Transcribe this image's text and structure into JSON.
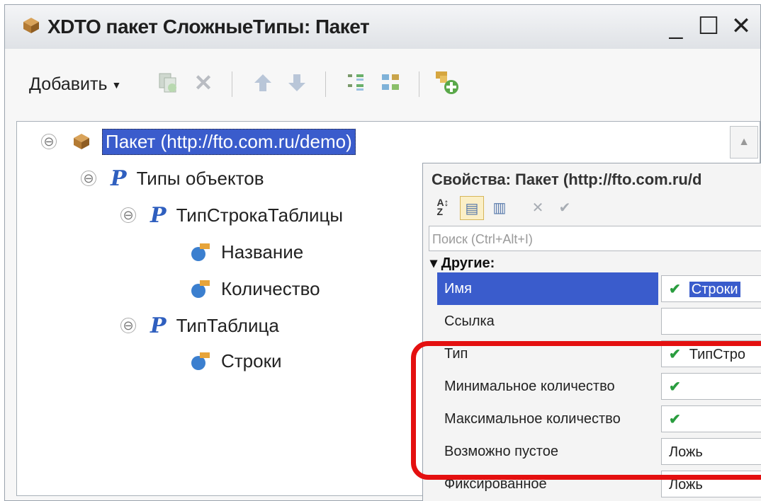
{
  "window": {
    "title": "XDTO пакет СложныеТипы: Пакет",
    "buttons": {
      "minimize": "_",
      "maximize": "☐",
      "close": "✕"
    }
  },
  "toolbar": {
    "add_label": "Добавить",
    "icons": [
      "copy-icon",
      "delete-icon",
      "move-up-icon",
      "move-down-icon",
      "sort-icon",
      "group-icon",
      "add-package-icon"
    ]
  },
  "tree": {
    "root": {
      "label": "Пакет (http://fto.com.ru/demo)",
      "collapse": "⊖"
    },
    "object_types": {
      "label": "Типы объектов",
      "collapse": "⊖"
    },
    "type_row": {
      "label": "ТипСтрокаТаблицы",
      "collapse": "⊖"
    },
    "prop_name": {
      "label": "Название"
    },
    "prop_qty": {
      "label": "Количество"
    },
    "type_table": {
      "label": "ТипТаблица",
      "collapse": "⊖"
    },
    "prop_rows": {
      "label": "Строки"
    }
  },
  "properties": {
    "title": "Свойства: Пакет (http://fto.com.ru/d",
    "search_placeholder": "Поиск (Ctrl+Alt+I)",
    "group": "▾ Другие:",
    "rows": [
      {
        "name": "Имя",
        "value": "Строки",
        "check": "✔"
      },
      {
        "name": "Ссылка",
        "value": "",
        "check": ""
      },
      {
        "name": "Тип",
        "value": "ТипСтро",
        "check": "✔"
      },
      {
        "name": "Минимальное количество",
        "value": "",
        "check": "✔"
      },
      {
        "name": "Максимальное количество",
        "value": "",
        "check": "✔"
      },
      {
        "name": "Возможно пустое",
        "value": "Ложь",
        "check": ""
      },
      {
        "name": "Фиксированное",
        "value": "Ложь",
        "check": ""
      }
    ]
  },
  "colors": {
    "selection": "#3a5ccc",
    "highlight": "#e41010",
    "check": "#2a9d3f"
  }
}
